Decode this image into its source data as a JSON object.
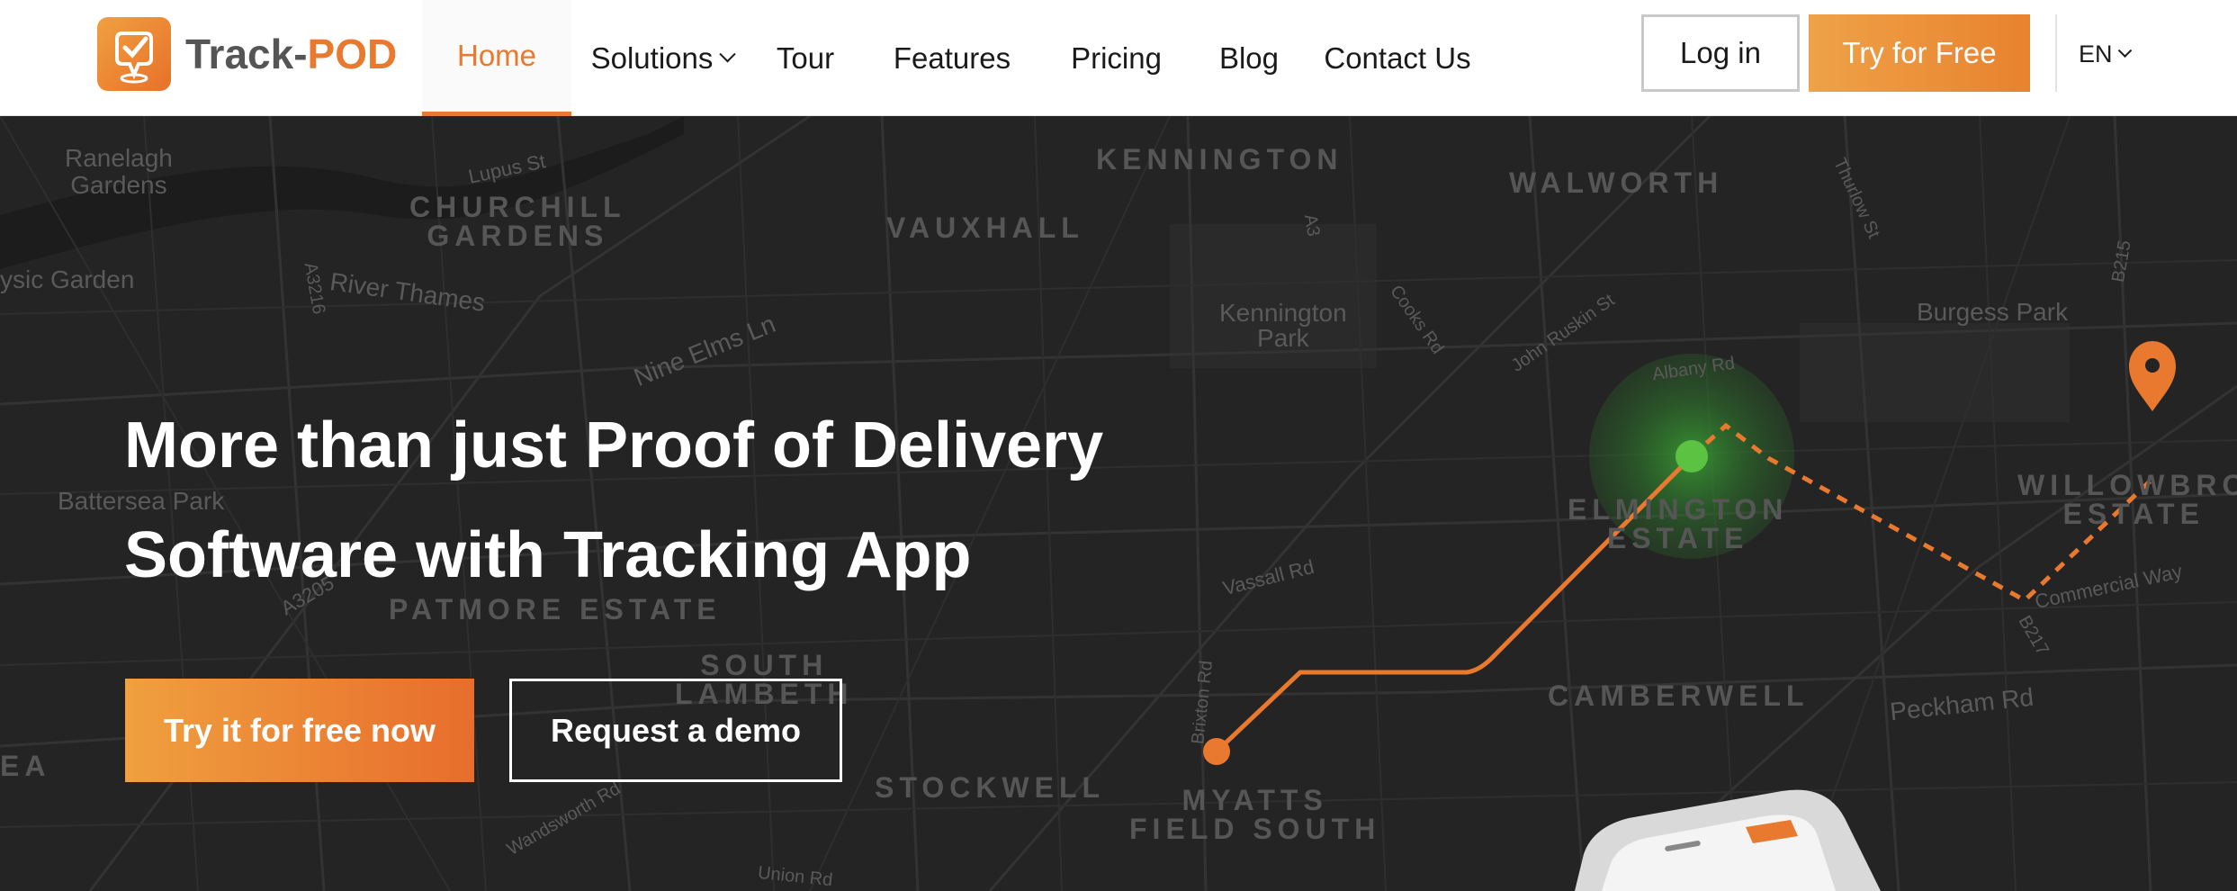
{
  "brand": {
    "name_part1": "Track-",
    "name_part2": "POD",
    "accent": "#e8792e"
  },
  "nav": {
    "items": [
      {
        "label": "Home",
        "active": true
      },
      {
        "label": "Solutions",
        "has_dropdown": true
      },
      {
        "label": "Tour"
      },
      {
        "label": "Features"
      },
      {
        "label": "Pricing"
      },
      {
        "label": "Blog"
      },
      {
        "label": "Contact Us"
      }
    ],
    "login_label": "Log in",
    "try_label": "Try for Free",
    "language": "EN"
  },
  "hero": {
    "headline_line1": "More than just Proof of Delivery",
    "headline_line2": "Software with Tracking App",
    "cta_primary": "Try it for free now",
    "cta_secondary": "Request a demo"
  },
  "map": {
    "labels": {
      "ranelagh": "Ranelagh\nGardens",
      "churchill": "CHURCHILL\nGARDENS",
      "vauxhall": "VAUXHALL",
      "kennington": "KENNINGTON",
      "walworth": "WALWORTH",
      "physic": "ysic Garden",
      "river": "River Thames",
      "nineelms": "Nine Elms Ln",
      "kenpark": "Kennington\nPark",
      "burgess": "Burgess Park",
      "battersea": "Battersea Park",
      "elmington": "ELMINGTON\nESTATE",
      "willowbrook": "WILLOWBRO\nESTATE",
      "patmore": "PATMORE ESTATE",
      "southlambeth": "SOUTH\nLAMBETH",
      "camberwell": "CAMBERWELL",
      "stockwell": "STOCKWELL",
      "myatts": "MYATTS\nFIELD SOUTH",
      "peckham": "Peckham Rd",
      "vassall": "Vassall Rd",
      "commercial": "Commercial Way",
      "ea": "EA",
      "lupus": "Lupus St",
      "albany": "Albany Rd",
      "a3": "A3",
      "a3205": "A3205",
      "a3216": "A3216",
      "b217": "B217",
      "b215": "B215",
      "brixton": "Brixton Rd",
      "wandsworth": "Wandsworth Rd",
      "cooks": "Cooks Rd",
      "ruskin": "John Ruskin St",
      "thurlow": "Thurlow St",
      "union": "Union Rd"
    }
  }
}
